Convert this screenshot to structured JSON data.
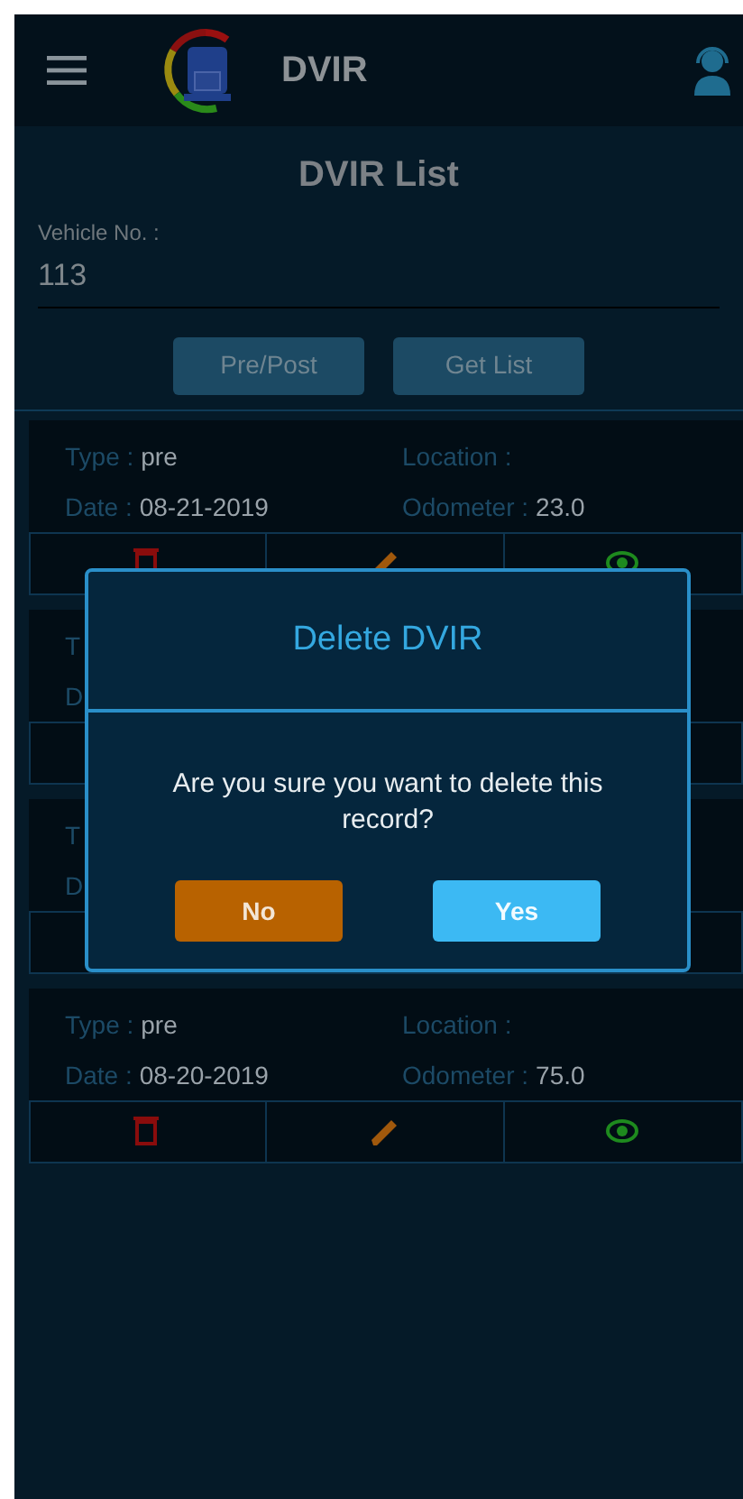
{
  "app_bar": {
    "title": "DVIR"
  },
  "page_title": "DVIR List",
  "vehicle": {
    "label": "Vehicle No. :",
    "value": "113"
  },
  "buttons": [
    "Pre/Post",
    "Get List"
  ],
  "cards": [
    {
      "type_label": "Type :",
      "type": "pre",
      "location_label": "Location :",
      "date_label": "Date :",
      "date": "08-21-2019",
      "odometer_label": "Odometer :",
      "odometer": "23.0"
    },
    {
      "type_label": "T",
      "date_label": "D"
    },
    {
      "type_label": "T",
      "date_label": "D"
    },
    {
      "type_label": "Type :",
      "type": "pre",
      "location_label": "Location :",
      "date_label": "Date :",
      "date": "08-20-2019",
      "odometer_label": "Odometer :",
      "odometer": "75.0"
    }
  ],
  "dialog": {
    "title": "Delete DVIR",
    "message": "Are you sure you want to delete this record?",
    "buttons": [
      {
        "label": "No",
        "kind": "cancel"
      },
      {
        "label": "Yes",
        "kind": "confirm"
      }
    ]
  }
}
